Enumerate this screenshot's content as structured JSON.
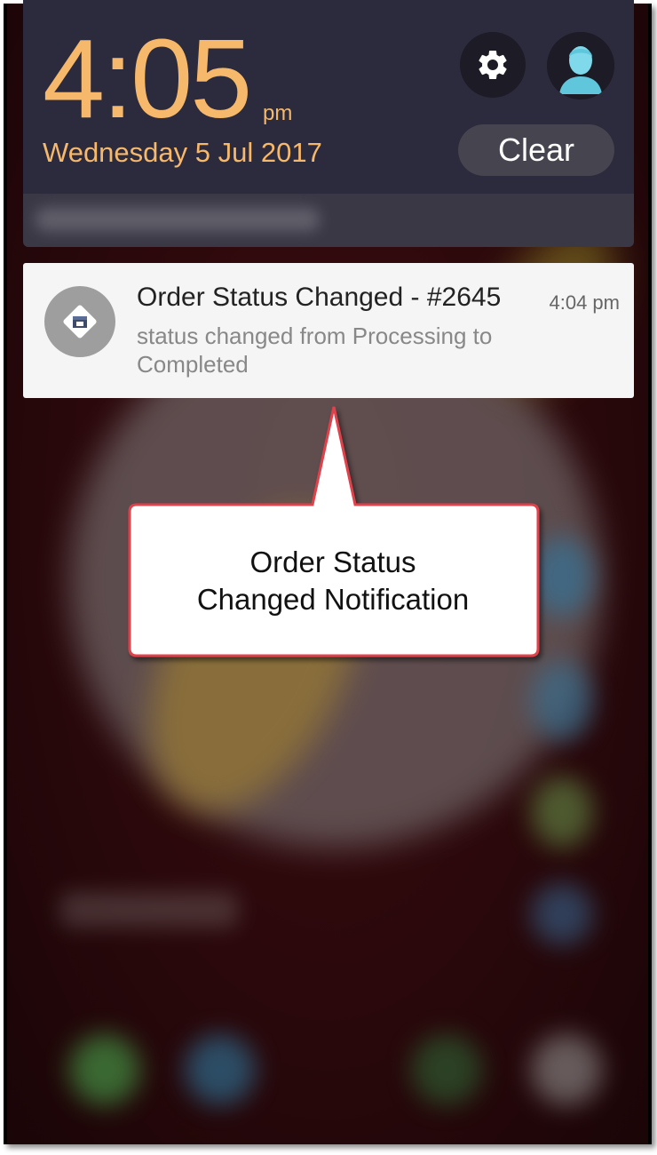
{
  "lockscreen": {
    "time": "4:05",
    "ampm": "pm",
    "date": "Wednesday 5 Jul 2017",
    "clear_label": "Clear",
    "accent_color": "#f6b86a",
    "settings_icon": "gear-icon",
    "avatar_icon": "user-avatar-icon"
  },
  "notification": {
    "title": "Order Status Changed - #2645",
    "time": "4:04 pm",
    "body": "status changed from Processing to Completed",
    "app_icon": "store-icon"
  },
  "callout": {
    "text_line1": "Order Status",
    "text_line2": "Changed Notification",
    "border_color": "#e0424b"
  }
}
